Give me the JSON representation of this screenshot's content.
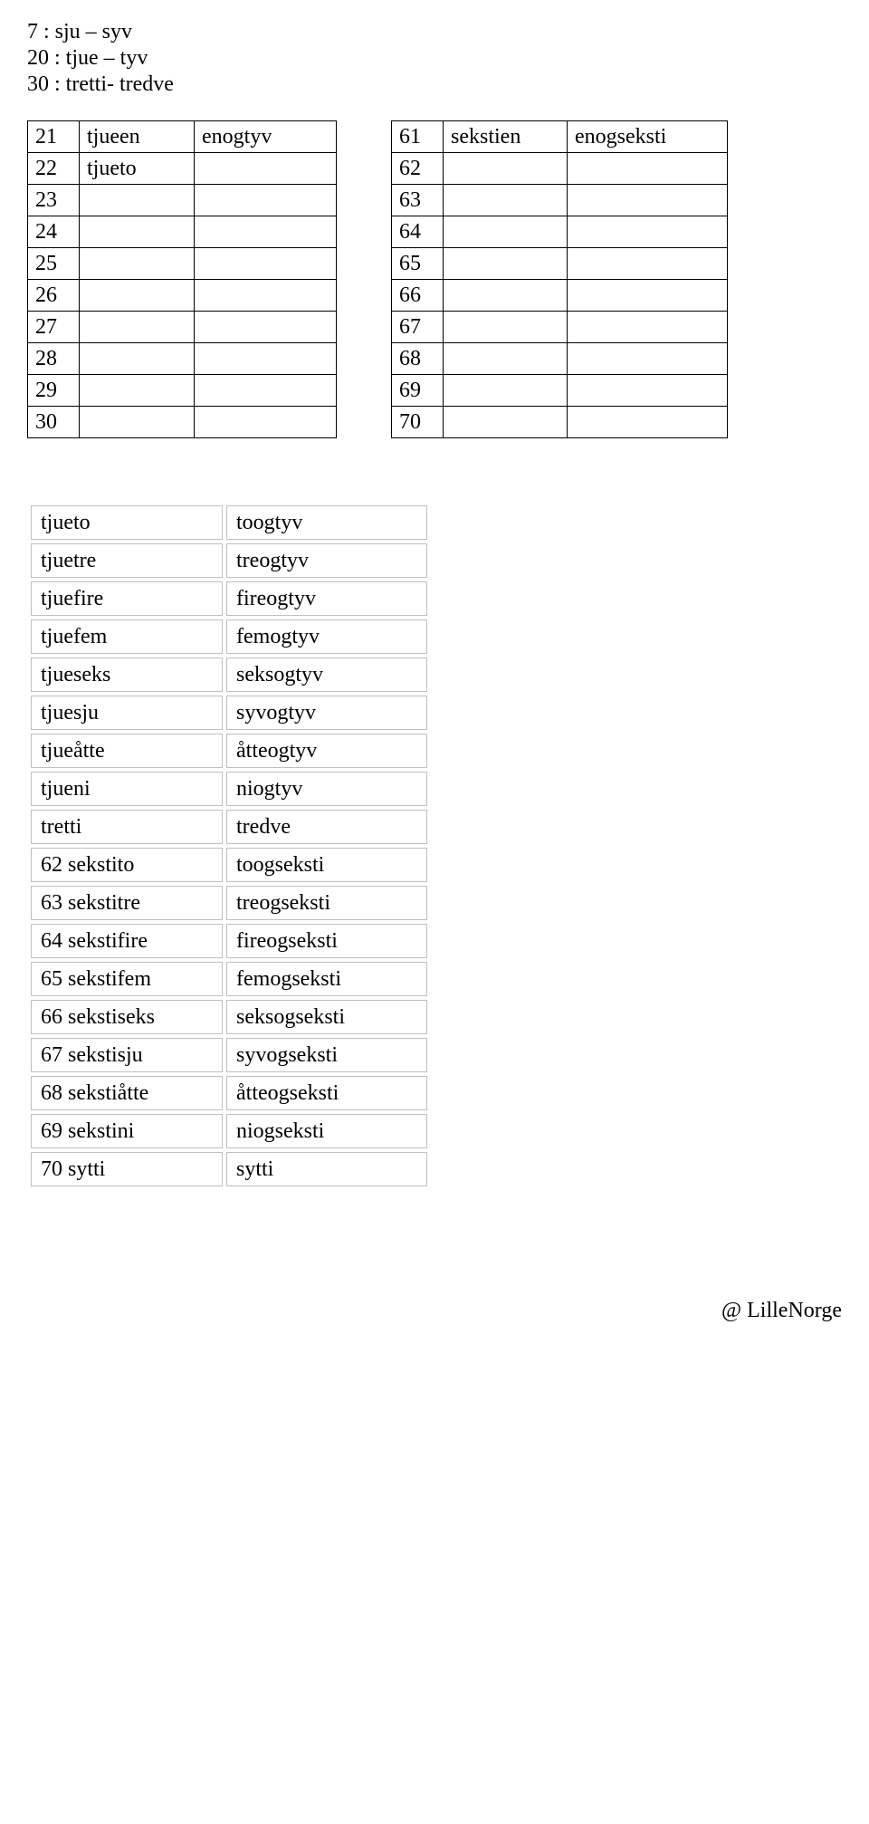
{
  "intro": {
    "l1": "7   : sju – syv",
    "l2": "20 : tjue – tyv",
    "l3": "30 :  tretti- tredve"
  },
  "table_left": [
    {
      "n": "21",
      "a": "tjueen",
      "b": "enogtyv"
    },
    {
      "n": "22",
      "a": "tjueto",
      "b": ""
    },
    {
      "n": "23",
      "a": "",
      "b": ""
    },
    {
      "n": "24",
      "a": "",
      "b": ""
    },
    {
      "n": "25",
      "a": "",
      "b": ""
    },
    {
      "n": "26",
      "a": "",
      "b": ""
    },
    {
      "n": "27",
      "a": "",
      "b": ""
    },
    {
      "n": "28",
      "a": "",
      "b": ""
    },
    {
      "n": "29",
      "a": "",
      "b": ""
    },
    {
      "n": "30",
      "a": "",
      "b": ""
    }
  ],
  "table_right": [
    {
      "n": "61",
      "a": "sekstien",
      "b": "enogseksti"
    },
    {
      "n": "62",
      "a": "",
      "b": ""
    },
    {
      "n": "63",
      "a": "",
      "b": ""
    },
    {
      "n": "64",
      "a": "",
      "b": ""
    },
    {
      "n": "65",
      "a": "",
      "b": ""
    },
    {
      "n": "66",
      "a": "",
      "b": ""
    },
    {
      "n": "67",
      "a": "",
      "b": ""
    },
    {
      "n": "68",
      "a": "",
      "b": ""
    },
    {
      "n": "69",
      "a": "",
      "b": ""
    },
    {
      "n": "70",
      "a": "",
      "b": ""
    }
  ],
  "word_pairs": [
    {
      "a": "tjueto",
      "b": "toogtyv"
    },
    {
      "a": "tjuetre",
      "b": "treogtyv"
    },
    {
      "a": "tjuefire",
      "b": "fireogtyv"
    },
    {
      "a": "tjuefem",
      "b": "femogtyv"
    },
    {
      "a": "tjueseks",
      "b": "seksogtyv"
    },
    {
      "a": "tjuesju",
      "b": "syvogtyv"
    },
    {
      "a": "tjueåtte",
      "b": "åtteogtyv"
    },
    {
      "a": "tjueni",
      "b": "niogtyv"
    },
    {
      "a": "tretti",
      "b": "tredve"
    },
    {
      "a": "62 sekstito",
      "b": "toogseksti"
    },
    {
      "a": "63 sekstitre",
      "b": "treogseksti"
    },
    {
      "a": "64 sekstifire",
      "b": "fireogseksti"
    },
    {
      "a": "65 sekstifem",
      "b": "femogseksti"
    },
    {
      "a": "66 sekstiseks",
      "b": "seksogseksti"
    },
    {
      "a": "67 sekstisju",
      "b": "syvogseksti"
    },
    {
      "a": "68 sekstiåtte",
      "b": "åtteogseksti"
    },
    {
      "a": "69 sekstini",
      "b": "niogseksti"
    },
    {
      "a": "70 sytti",
      "b": "sytti"
    }
  ],
  "footer": "@ LilleNorge"
}
